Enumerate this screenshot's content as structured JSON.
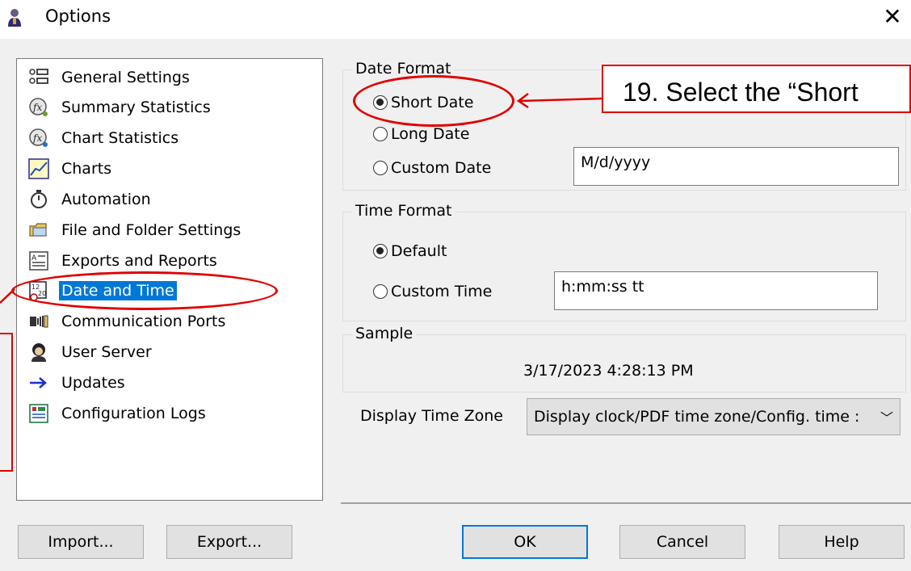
{
  "window": {
    "title": "Options"
  },
  "nav": {
    "items": [
      {
        "label": "General Settings",
        "icon": "settings-list-icon"
      },
      {
        "label": "Summary Statistics",
        "icon": "fx-statistics-icon"
      },
      {
        "label": "Chart Statistics",
        "icon": "fx-statistics-icon"
      },
      {
        "label": "Charts",
        "icon": "chart-line-icon"
      },
      {
        "label": "Automation",
        "icon": "stopwatch-icon"
      },
      {
        "label": "File and Folder Settings",
        "icon": "folder-icon"
      },
      {
        "label": "Exports and Reports",
        "icon": "report-icon"
      },
      {
        "label": "Date and Time",
        "icon": "calendar-clock-icon"
      },
      {
        "label": "Communication Ports",
        "icon": "port-icon"
      },
      {
        "label": "User Server",
        "icon": "user-server-icon"
      },
      {
        "label": "Updates",
        "icon": "arrow-right-icon"
      },
      {
        "label": "Configuration Logs",
        "icon": "log-icon"
      }
    ],
    "selected": "Date and Time"
  },
  "date_format": {
    "group_label": "Date Format",
    "options": [
      "Short Date",
      "Long Date",
      "Custom Date"
    ],
    "selected": "Short Date",
    "custom_value": "M/d/yyyy"
  },
  "time_format": {
    "group_label": "Time Format",
    "options": [
      "Default",
      "Custom Time"
    ],
    "selected": "Default",
    "custom_value": "h:mm:ss tt"
  },
  "sample": {
    "group_label": "Sample",
    "value": "3/17/2023 4:28:13 PM"
  },
  "time_zone": {
    "label": "Display Time Zone",
    "selected": "Display clock/PDF time zone/Config. time :"
  },
  "buttons": {
    "import": "Import...",
    "export": "Export...",
    "ok": "OK",
    "cancel": "Cancel",
    "help": "Help"
  },
  "annotation": {
    "callout_text": "19. Select the “Short",
    "color": "#e00000"
  },
  "colors": {
    "selection": "#0078d7",
    "dialog_bg": "#f0f0f0"
  }
}
